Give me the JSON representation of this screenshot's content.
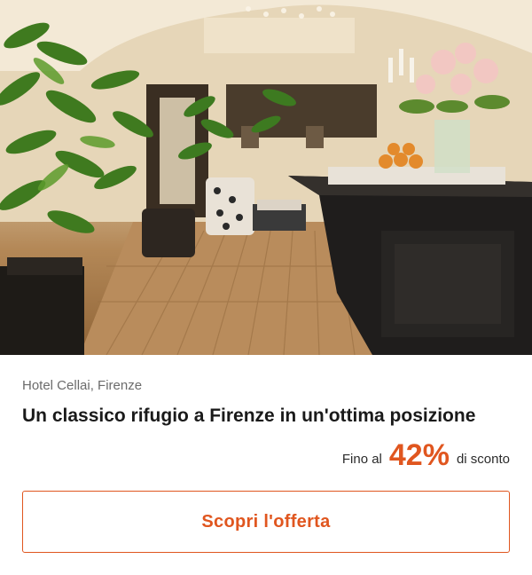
{
  "offer": {
    "location": "Hotel Cellai, Firenze",
    "title": "Un classico rifugio a Firenze in un'ottima posizione",
    "discount": {
      "prefix": "Fino al",
      "value": "42%",
      "suffix": "di sconto"
    },
    "cta_label": "Scopri l'offerta"
  },
  "colors": {
    "accent": "#e0561f",
    "text_primary": "#1a1a1a",
    "text_secondary": "#6b6b6b"
  }
}
